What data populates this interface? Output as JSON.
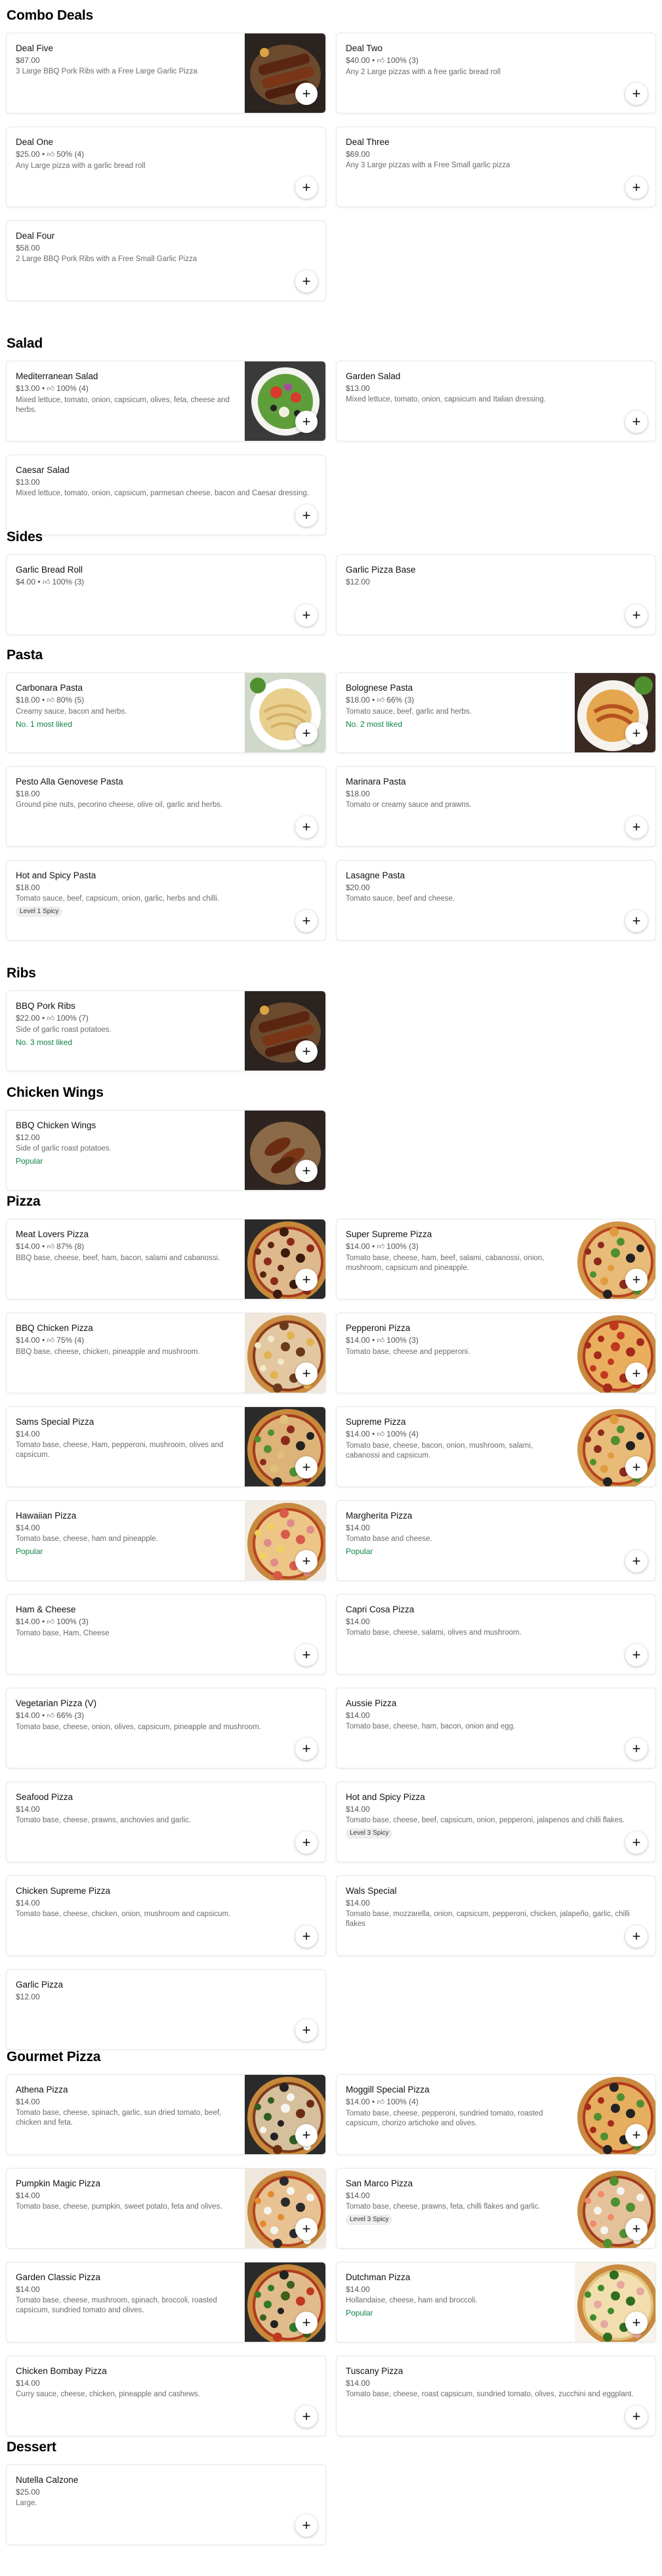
{
  "add_icon": "plus-icon",
  "thumb_icon": "thumbs-up-icon",
  "colors": {
    "popular": "#0e8345",
    "badge_bg": "#eeeeee",
    "text_muted": "#6b6b6b"
  },
  "sections": [
    {
      "title": "Combo Deals",
      "items": [
        {
          "name": "Deal Five",
          "price": "$87.00",
          "desc": "3 Large BBQ Pork Ribs with a Free Large Garlic Pizza",
          "image": "ribs"
        },
        {
          "name": "Deal Two",
          "price": "$40.00",
          "rating": "100% (3)",
          "desc": "Any 2 Large pizzas with a free garlic bread roll"
        },
        {
          "name": "Deal One",
          "price": "$25.00",
          "rating": "50% (4)",
          "desc": "Any Large pizza with a garlic bread roll"
        },
        {
          "name": "Deal Three",
          "price": "$69.00",
          "desc": "Any 3 Large pizzas with a Free Small garlic pizza"
        },
        {
          "name": "Deal Four",
          "price": "$58.00",
          "desc": "2 Large BBQ Pork Ribs with a Free Small Garlic Pizza"
        }
      ]
    },
    {
      "title": "Salad",
      "items": [
        {
          "name": "Mediterranean Salad",
          "price": "$13.00",
          "rating": "100% (4)",
          "desc": "Mixed lettuce, tomato, onion, capsicum, olives, feta, cheese and herbs.",
          "image": "salad"
        },
        {
          "name": "Garden Salad",
          "price": "$13.00",
          "desc": "Mixed lettuce, tomato, onion, capsicum and Italian dressing."
        },
        {
          "name": "Caesar Salad",
          "price": "$13.00",
          "desc": "Mixed lettuce, tomato, onion, capsicum, parmesan cheese, bacon and Caesar dressing."
        }
      ]
    },
    {
      "title": "Sides",
      "items": [
        {
          "name": "Garlic Bread Roll",
          "price": "$4.00",
          "rating": "100% (3)"
        },
        {
          "name": "Garlic Pizza Base",
          "price": "$12.00"
        }
      ]
    },
    {
      "title": "Pasta",
      "items": [
        {
          "name": "Carbonara Pasta",
          "price": "$18.00",
          "rating": "80% (5)",
          "desc": "Creamy sauce, bacon and herbs.",
          "tag": "No. 1 most liked",
          "image": "carbonara"
        },
        {
          "name": "Bolognese Pasta",
          "price": "$18.00",
          "rating": "66% (3)",
          "desc": "Tomato sauce, beef, garlic and herbs.",
          "tag": "No. 2 most liked",
          "image": "bolognese"
        },
        {
          "name": "Pesto Alla Genovese Pasta",
          "price": "$18.00",
          "desc": "Ground pine nuts, pecorino cheese, olive oil, garlic and herbs."
        },
        {
          "name": "Marinara Pasta",
          "price": "$18.00",
          "desc": "Tomato or creamy sauce and prawns."
        },
        {
          "name": "Hot and Spicy Pasta",
          "price": "$18.00",
          "desc": "Tomato sauce, beef, capsicum, onion, garlic, herbs and chilli.",
          "badge": "Level 1 Spicy"
        },
        {
          "name": "Lasagne Pasta",
          "price": "$20.00",
          "desc": "Tomato sauce, beef and cheese."
        }
      ]
    },
    {
      "title": "Ribs",
      "items": [
        {
          "name": "BBQ Pork Ribs",
          "price": "$22.00",
          "rating": "100% (7)",
          "desc": "Side of garlic roast potatoes.",
          "tag": "No. 3 most liked",
          "image": "ribs"
        }
      ]
    },
    {
      "title": "Chicken Wings",
      "items": [
        {
          "name": "BBQ Chicken Wings",
          "price": "$12.00",
          "desc": "Side of garlic roast potatoes.",
          "tag": "Popular",
          "image": "wings"
        }
      ]
    },
    {
      "title": "Pizza",
      "items": [
        {
          "name": "Meat Lovers Pizza",
          "price": "$14.00",
          "rating": "87% (8)",
          "desc": "BBQ base, cheese, beef, ham, bacon, salami and cabanossi.",
          "image": "pizza-meat"
        },
        {
          "name": "Super Supreme Pizza",
          "price": "$14.00",
          "rating": "100% (3)",
          "desc": "Tomato base, cheese, ham, beef, salami, cabanossi, onion, mushroom, capsicum and pineapple.",
          "image": "pizza-supreme"
        },
        {
          "name": "BBQ Chicken Pizza",
          "price": "$14.00",
          "rating": "75% (4)",
          "desc": "BBQ base, cheese, chicken, pineapple and mushroom.",
          "image": "pizza-chicken"
        },
        {
          "name": "Pepperoni Pizza",
          "price": "$14.00",
          "rating": "100% (3)",
          "desc": "Tomato base, cheese and pepperoni.",
          "image": "pizza-pepperoni"
        },
        {
          "name": "Sams Special Pizza",
          "price": "$14.00",
          "desc": "Tomato base, cheese, Ham, pepperoni, mushroom, olives and capsicum.",
          "image": "pizza-special"
        },
        {
          "name": "Supreme Pizza",
          "price": "$14.00",
          "rating": "100% (4)",
          "desc": "Tomato base, cheese, bacon, onion, mushroom, salami, cabanossi and capsicum.",
          "image": "pizza-supreme"
        },
        {
          "name": "Hawaiian Pizza",
          "price": "$14.00",
          "desc": "Tomato base, cheese, ham and pineapple.",
          "tag": "Popular",
          "image": "pizza-hawaiian"
        },
        {
          "name": "Margherita Pizza",
          "price": "$14.00",
          "desc": "Tomato base and cheese.",
          "tag": "Popular"
        },
        {
          "name": "Ham & Cheese",
          "price": "$14.00",
          "rating": "100% (3)",
          "desc": "Tomato base, Ham, Cheese"
        },
        {
          "name": "Capri Cosa Pizza",
          "price": "$14.00",
          "desc": "Tomato base, cheese, salami, olives and mushroom."
        },
        {
          "name": "Vegetarian Pizza (V)",
          "price": "$14.00",
          "rating": "66% (3)",
          "desc": "Tomato base, cheese, onion, olives, capsicum, pineapple and mushroom."
        },
        {
          "name": "Aussie Pizza",
          "price": "$14.00",
          "desc": "Tomato base, cheese, ham, bacon, onion and egg."
        },
        {
          "name": "Seafood Pizza",
          "price": "$14.00",
          "desc": "Tomato base, cheese, prawns, anchovies and garlic."
        },
        {
          "name": "Hot and Spicy Pizza",
          "price": "$14.00",
          "desc": "Tomato base, cheese, beef, capsicum, onion, pepperoni, jalapenos and chilli flakes.",
          "badge": "Level 3 Spicy"
        },
        {
          "name": "Chicken Supreme Pizza",
          "price": "$14.00",
          "desc": "Tomato base, cheese, chicken, onion, mushroom and capsicum."
        },
        {
          "name": "Wals Special",
          "price": "$14.00",
          "desc": "Tomato base, mozzarella, onion, capsicum, pepperoni, chicken, jalapeño, garlic, chilli flakes"
        },
        {
          "name": "Garlic Pizza",
          "price": "$12.00"
        }
      ]
    },
    {
      "title": "Gourmet Pizza",
      "items": [
        {
          "name": "Athena Pizza",
          "price": "$14.00",
          "desc": "Tomato base, cheese, spinach, garlic, sun dried tomato, beef, chicken and feta.",
          "image": "pizza-athena"
        },
        {
          "name": "Moggill Special Pizza",
          "price": "$14.00",
          "rating": "100% (4)",
          "desc": "Tomato base, cheese, pepperoni, sundried tomato, roasted capsicum, chorizo artichoke and olives.",
          "image": "pizza-moggill"
        },
        {
          "name": "Pumpkin Magic Pizza",
          "price": "$14.00",
          "desc": "Tomato base, cheese, pumpkin, sweet potato, feta and olives.",
          "image": "pizza-pumpkin"
        },
        {
          "name": "San Marco Pizza",
          "price": "$14.00",
          "desc": "Tomato base, cheese, prawns, feta, chilli flakes and garlic.",
          "badge": "Level 3 Spicy",
          "image": "pizza-sanmarco"
        },
        {
          "name": "Garden Classic Pizza",
          "price": "$14.00",
          "desc": "Tomato base, cheese, mushroom, spinach, broccoli, roasted capsicum, sundried tomato and olives.",
          "image": "pizza-garden"
        },
        {
          "name": "Dutchman Pizza",
          "price": "$14.00",
          "desc": "Hollandaise, cheese, ham and broccoli.",
          "tag": "Popular",
          "image": "pizza-dutchman"
        },
        {
          "name": "Chicken Bombay Pizza",
          "price": "$14.00",
          "desc": "Curry sauce, cheese, chicken, pineapple and cashews."
        },
        {
          "name": "Tuscany Pizza",
          "price": "$14.00",
          "desc": "Tomato base, cheese, roast capsicum, sundried tomato, olives, zucchini and eggplant."
        }
      ]
    },
    {
      "title": "Dessert",
      "items": [
        {
          "name": "Nutella Calzone",
          "price": "$25.00",
          "desc": "Large."
        }
      ]
    }
  ]
}
